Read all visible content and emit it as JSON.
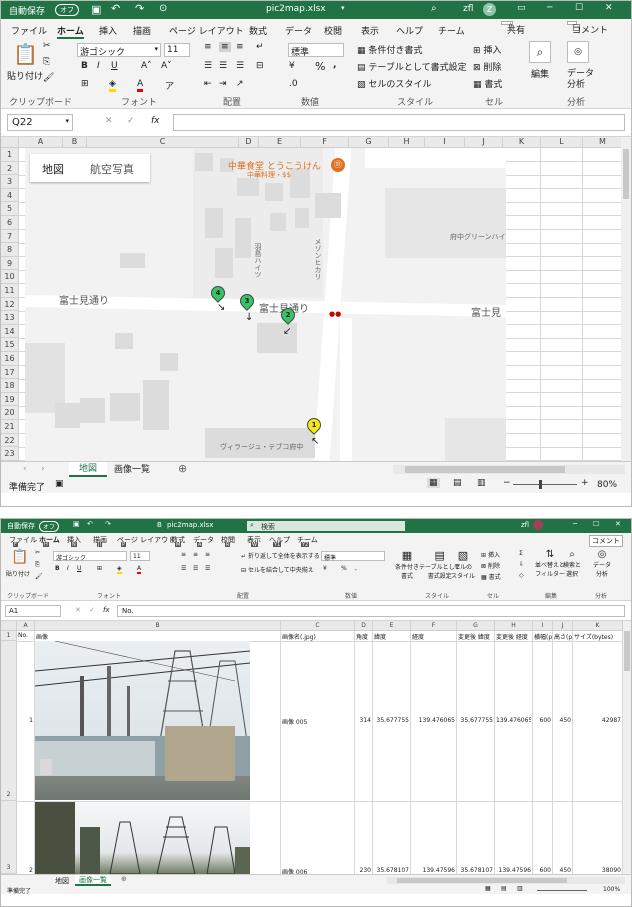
{
  "w1": {
    "autosave": "自動保存",
    "autosave_state": "オフ",
    "filename": "pic2map.xlsx",
    "user": "zfl",
    "user_initial": "Z",
    "tabs": [
      "ファイル",
      "ホーム",
      "挿入",
      "描画",
      "ページ レイアウト",
      "数式",
      "データ",
      "校閲",
      "表示",
      "ヘルプ",
      "チーム"
    ],
    "share": "共有",
    "comment": "コメント",
    "ribbon": {
      "paste": "貼り付け",
      "font_name": "游ゴシック",
      "font_size": "11",
      "number_format": "標準",
      "cond_format": "条件付き書式",
      "table_format": "テーブルとして書式設定",
      "cell_style": "セルのスタイル",
      "insert": "挿入",
      "delete": "削除",
      "format": "書式",
      "edit": "編集",
      "data_analysis_1": "データ",
      "data_analysis_2": "分析",
      "groups": [
        "クリップボード",
        "フォント",
        "配置",
        "数値",
        "スタイル",
        "セル",
        "分析"
      ],
      "percent": "%"
    },
    "namebox": "Q22",
    "fx": "fx",
    "cols": [
      "A",
      "B",
      "C",
      "D",
      "E",
      "F",
      "G",
      "H",
      "I",
      "J",
      "K",
      "L",
      "M"
    ],
    "rows": [
      "1",
      "2",
      "3",
      "4",
      "5",
      "6",
      "7",
      "8",
      "9",
      "10",
      "11",
      "12",
      "13",
      "14",
      "15",
      "16",
      "17",
      "18",
      "19",
      "20",
      "21",
      "22",
      "23"
    ],
    "map": {
      "btn_map": "地図",
      "btn_aerial": "航空写真",
      "restaurant": "中華食堂 とうこうけん",
      "restaurant_sub": "中華料理・$$",
      "road1": "富士見通り",
      "road2": "富士見通り",
      "road3": "富士見",
      "bldg1": "府中グリーンハイ",
      "bldg2": "羽島ハイツ",
      "bldg3": "メゾンヒカリ",
      "bldg4": "ヴィラージュ・テブコ府中",
      "markers": [
        "4",
        "3",
        "2",
        "1"
      ]
    },
    "sheets": [
      "地図",
      "画像一覧"
    ],
    "status": "準備完了",
    "zoom": "80%"
  },
  "w2": {
    "autosave": "自動保存",
    "autosave_state": "オフ",
    "filename": "pic2map.xlsx",
    "search": "検索",
    "user": "zfl",
    "tabs": [
      {
        "label": "ファイル",
        "key": "F"
      },
      {
        "label": "ホーム",
        "key": "H"
      },
      {
        "label": "挿入",
        "key": "N"
      },
      {
        "label": "描画",
        "key": "JI"
      },
      {
        "label": "ページ レイアウト",
        "key": "P"
      },
      {
        "label": "数式",
        "key": "M"
      },
      {
        "label": "データ",
        "key": "A"
      },
      {
        "label": "校閲",
        "key": "R"
      },
      {
        "label": "表示",
        "key": "W"
      },
      {
        "label": "ヘルプ",
        "key": "Y1"
      },
      {
        "label": "チーム",
        "key": "Y2"
      }
    ],
    "comment": "コメント",
    "ribbon": {
      "paste": "貼り付け",
      "font_name": "游ゴシック",
      "font_size": "11",
      "wrap": "折り返して全体を表示する",
      "merge": "セルを結合して中央揃え",
      "number_format": "標準",
      "cond_1": "条件付き",
      "cond_2": "書式",
      "table_1": "テーブルとして",
      "table_2": "書式設定",
      "style_1": "セルの",
      "style_2": "スタイル",
      "insert": "挿入",
      "delete": "削除",
      "format": "書式",
      "sort_1": "並べ替えと",
      "sort_2": "フィルター",
      "find_1": "検索と",
      "find_2": "選択",
      "data_1": "データ",
      "data_2": "分析",
      "groups": [
        "クリップボード",
        "フォント",
        "配置",
        "数値",
        "スタイル",
        "セル",
        "編集",
        "分析"
      ]
    },
    "namebox": "A1",
    "formula": "No.",
    "cols": [
      "A",
      "B",
      "C",
      "D",
      "E",
      "F",
      "G",
      "H",
      "I",
      "J",
      "K"
    ],
    "header": [
      "No.",
      "画像",
      "画像名(.jpg)",
      "角度",
      "緯度",
      "経度",
      "変更後 緯度",
      "変更後 経度",
      "横幅(px)",
      "高さ(px)",
      "サイズ(bytes)"
    ],
    "records": [
      {
        "row": "2",
        "no": "1",
        "name": "画像 005",
        "angle": "314",
        "lat": "35.677755",
        "lon": "139.476065",
        "lat2": "35.677755",
        "lon2": "139.476065",
        "w": "600",
        "h": "450",
        "size": "42987"
      },
      {
        "row": "3",
        "no": "2",
        "name": "画像 006",
        "angle": "230",
        "lat": "35.678107",
        "lon": "139.47596",
        "lat2": "35.678107",
        "lon2": "139.47596",
        "w": "600",
        "h": "450",
        "size": "38090"
      }
    ],
    "sheets": [
      "地図",
      "画像一覧"
    ],
    "status": "準備完了",
    "zoom": "100%"
  }
}
